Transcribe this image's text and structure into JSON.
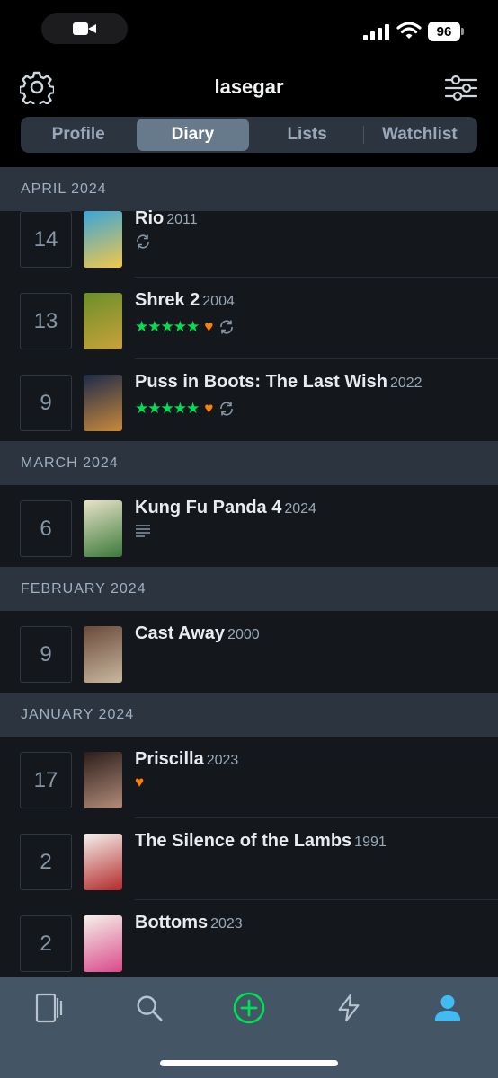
{
  "status_bar": {
    "battery": "96"
  },
  "header": {
    "username": "lasegar"
  },
  "tabs": [
    {
      "label": "Profile",
      "active": false
    },
    {
      "label": "Diary",
      "active": true
    },
    {
      "label": "Lists",
      "active": false
    },
    {
      "label": "Watchlist",
      "active": false
    }
  ],
  "diary": [
    {
      "month": "APRIL 2024",
      "entries": [
        {
          "day": "14",
          "title": "Rio",
          "year": "2011",
          "stars": 0,
          "liked": false,
          "rewatch": true,
          "review": false,
          "poster_colors": [
            "#3aa5d8",
            "#f2c84b"
          ]
        },
        {
          "day": "13",
          "title": "Shrek 2",
          "year": "2004",
          "stars": 5,
          "liked": true,
          "rewatch": true,
          "review": false,
          "poster_colors": [
            "#6b8f2a",
            "#c9a23a"
          ]
        },
        {
          "day": "9",
          "title": "Puss in Boots: The Last Wish",
          "year": "2022",
          "stars": 5,
          "liked": true,
          "rewatch": true,
          "review": false,
          "poster_colors": [
            "#1d2a4a",
            "#c98a3a"
          ]
        }
      ]
    },
    {
      "month": "MARCH 2024",
      "entries": [
        {
          "day": "6",
          "title": "Kung Fu Panda 4",
          "year": "2024",
          "stars": 0,
          "liked": false,
          "rewatch": false,
          "review": true,
          "poster_colors": [
            "#e9e2c9",
            "#3b7a3a"
          ]
        }
      ]
    },
    {
      "month": "FEBRUARY 2024",
      "entries": [
        {
          "day": "9",
          "title": "Cast Away",
          "year": "2000",
          "stars": 0,
          "liked": false,
          "rewatch": false,
          "review": false,
          "poster_colors": [
            "#6a4a3a",
            "#c9b8a0"
          ]
        }
      ]
    },
    {
      "month": "JANUARY 2024",
      "entries": [
        {
          "day": "17",
          "title": "Priscilla",
          "year": "2023",
          "stars": 0,
          "liked": true,
          "rewatch": false,
          "review": false,
          "poster_colors": [
            "#2b1e1a",
            "#b38c7a"
          ]
        },
        {
          "day": "2",
          "title": "The Silence of the Lambs",
          "year": "1991",
          "stars": 0,
          "liked": false,
          "rewatch": false,
          "review": false,
          "poster_colors": [
            "#f3f1ee",
            "#b32a2a"
          ]
        },
        {
          "day": "2",
          "title": "Bottoms",
          "year": "2023",
          "stars": 0,
          "liked": false,
          "rewatch": false,
          "review": false,
          "poster_colors": [
            "#f5f2ea",
            "#d94a8a"
          ]
        }
      ]
    }
  ],
  "tabbar": [
    {
      "icon": "films-icon",
      "active": false
    },
    {
      "icon": "search-icon",
      "active": false
    },
    {
      "icon": "add-icon",
      "active": false
    },
    {
      "icon": "activity-icon",
      "active": false
    },
    {
      "icon": "profile-icon",
      "active": true
    }
  ],
  "colors": {
    "accent_green": "#00e054",
    "accent_orange": "#ff8000",
    "accent_blue": "#40bcf4"
  }
}
